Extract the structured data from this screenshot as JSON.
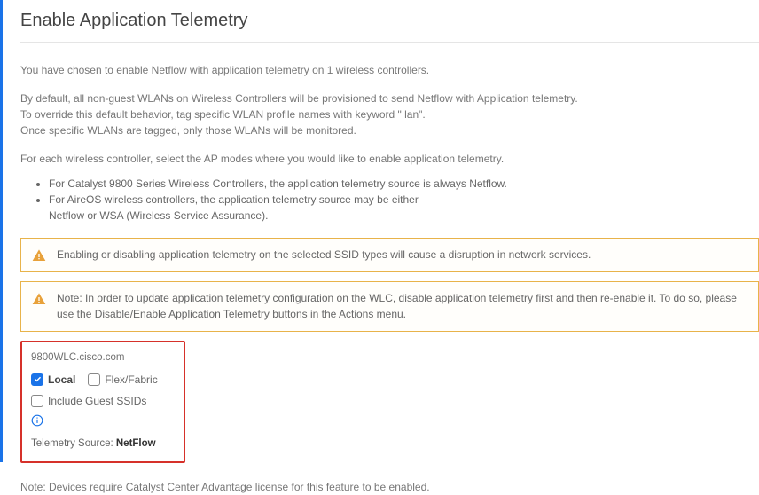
{
  "title": "Enable Application Telemetry",
  "intro": "You have chosen to enable Netflow with application telemetry on 1 wireless controllers.",
  "default_p1": "By default, all non-guest WLANs on Wireless Controllers will be provisioned to send Netflow with Application telemetry.",
  "default_p2": "To override this default behavior, tag specific WLAN profile names with keyword \" lan\".",
  "default_p3": "Once specific WLANs are tagged, only those WLANs will be monitored.",
  "each_ctrl": "For each wireless controller, select the AP modes where you would like to enable application telemetry.",
  "bullets": [
    "For Catalyst 9800 Series Wireless Controllers, the application telemetry source is always Netflow.",
    "For AireOS wireless controllers, the application telemetry source may be either",
    "Netflow or WSA (Wireless Service Assurance)."
  ],
  "alert1": "Enabling or disabling application telemetry on the selected SSID types will cause a disruption in network services.",
  "alert2": "Note: In order to update application telemetry configuration on the WLC, disable application telemetry first and then re-enable it. To do so, please use the Disable/Enable Application Telemetry buttons in the Actions menu.",
  "wlc": {
    "host": "9800WLC.cisco.com",
    "local_label": "Local",
    "flex_label": "Flex/Fabric",
    "guest_label": "Include Guest SSIDs",
    "telemetry_label": "Telemetry Source: ",
    "telemetry_value": "NetFlow",
    "local_checked": true,
    "flex_checked": false,
    "guest_checked": false
  },
  "footer": "Note: Devices require Catalyst Center Advantage license for this feature to be enabled."
}
